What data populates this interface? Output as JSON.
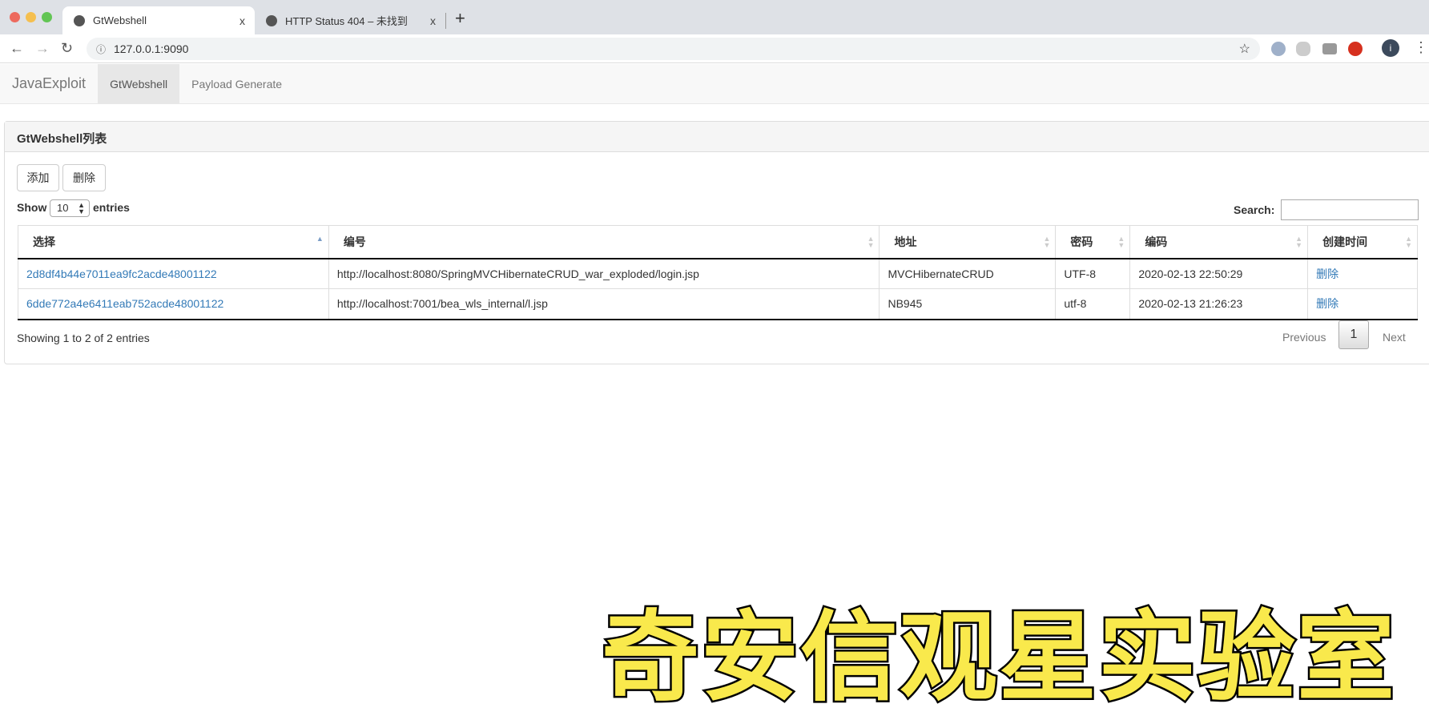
{
  "browser": {
    "tabs": [
      {
        "title": "GtWebshell",
        "active": true
      },
      {
        "title": "HTTP Status 404 – 未找到",
        "active": false
      }
    ],
    "new_tab": "+",
    "close": "x",
    "url": "127.0.0.1:9090",
    "avatar_letter": "i"
  },
  "navbar": {
    "brand": "JavaExploit",
    "links": [
      {
        "label": "GtWebshell",
        "active": true
      },
      {
        "label": "Payload Generate",
        "active": false
      }
    ]
  },
  "panel": {
    "title": "GtWebshell列表",
    "add_label": "添加",
    "delete_label": "删除",
    "show_label": "Show",
    "page_length": "10",
    "entries_label": "entries",
    "search_label": "Search:",
    "search_value": "",
    "columns": [
      "选择",
      "编号",
      "地址",
      "密码",
      "编码",
      "创建时间"
    ],
    "rows": [
      {
        "id": "2d8df4b44e7011ea9fc2acde48001122",
        "url": "http://localhost:8080/SpringMVCHibernateCRUD_war_exploded/login.jsp",
        "addr": "MVCHibernateCRUD",
        "pwd": "UTF-8",
        "time": "2020-02-13 22:50:29",
        "action": "删除"
      },
      {
        "id": "6dde772a4e6411eab752acde48001122",
        "url": "http://localhost:7001/bea_wls_internal/l.jsp",
        "addr": "NB945",
        "pwd": "utf-8",
        "time": "2020-02-13 21:26:23",
        "action": "删除"
      }
    ],
    "info": "Showing 1 to 2 of 2 entries",
    "pagination": {
      "previous": "Previous",
      "current": "1",
      "next": "Next"
    }
  },
  "watermark": "奇安信观星实验室",
  "colors": {
    "link": "#337ab7",
    "watermark": "#f9e94c"
  }
}
